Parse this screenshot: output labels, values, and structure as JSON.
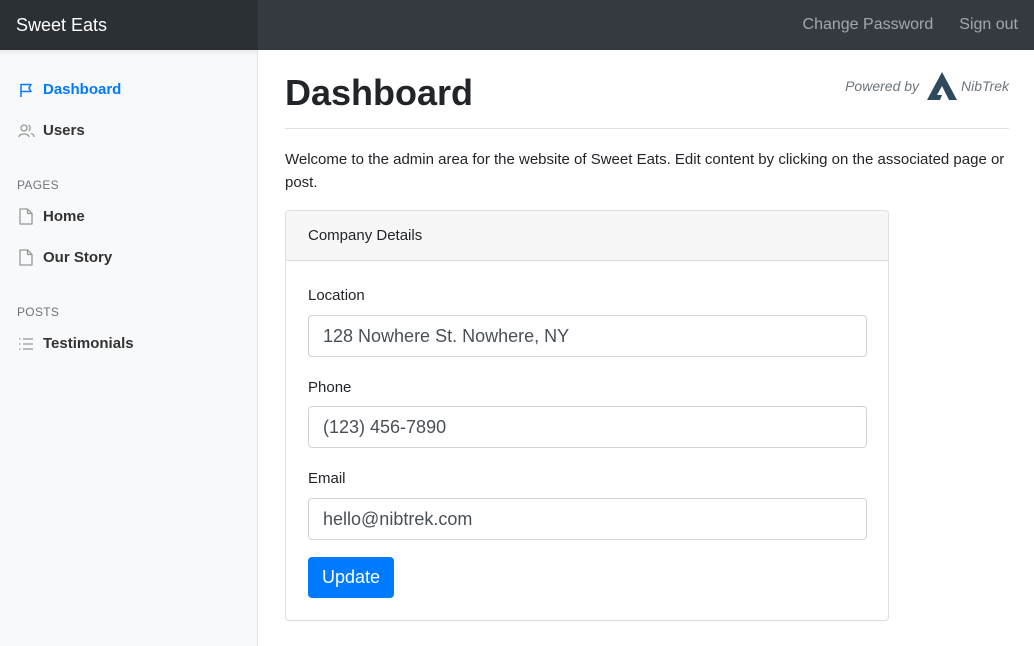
{
  "app": {
    "brand": "Sweet Eats"
  },
  "topnav": {
    "change_password": "Change Password",
    "sign_out": "Sign out"
  },
  "sidebar": {
    "items": [
      {
        "label": "Dashboard",
        "icon": "flag-icon",
        "active": true
      },
      {
        "label": "Users",
        "icon": "users-icon",
        "active": false
      }
    ],
    "pages_heading": "PAGES",
    "pages": [
      {
        "label": "Home",
        "icon": "file-icon"
      },
      {
        "label": "Our Story",
        "icon": "file-icon"
      }
    ],
    "posts_heading": "POSTS",
    "posts": [
      {
        "label": "Testimonials",
        "icon": "list-icon"
      }
    ]
  },
  "main": {
    "title": "Dashboard",
    "powered_by": "Powered by",
    "powered_brand": "NibTrek",
    "welcome": "Welcome to the admin area for the website of Sweet Eats. Edit content by clicking on the associated page or post."
  },
  "company": {
    "header": "Company Details",
    "location_label": "Location",
    "location_value": "128 Nowhere St. Nowhere, NY",
    "phone_label": "Phone",
    "phone_value": "(123) 456-7890",
    "email_label": "Email",
    "email_value": "hello@nibtrek.com",
    "update_label": "Update"
  },
  "colors": {
    "accent": "#007bff",
    "navbar": "#343a40",
    "brand_bg": "#2b3035",
    "sidebar_bg": "#f8f9fa",
    "logo": "#2f4a5c"
  }
}
